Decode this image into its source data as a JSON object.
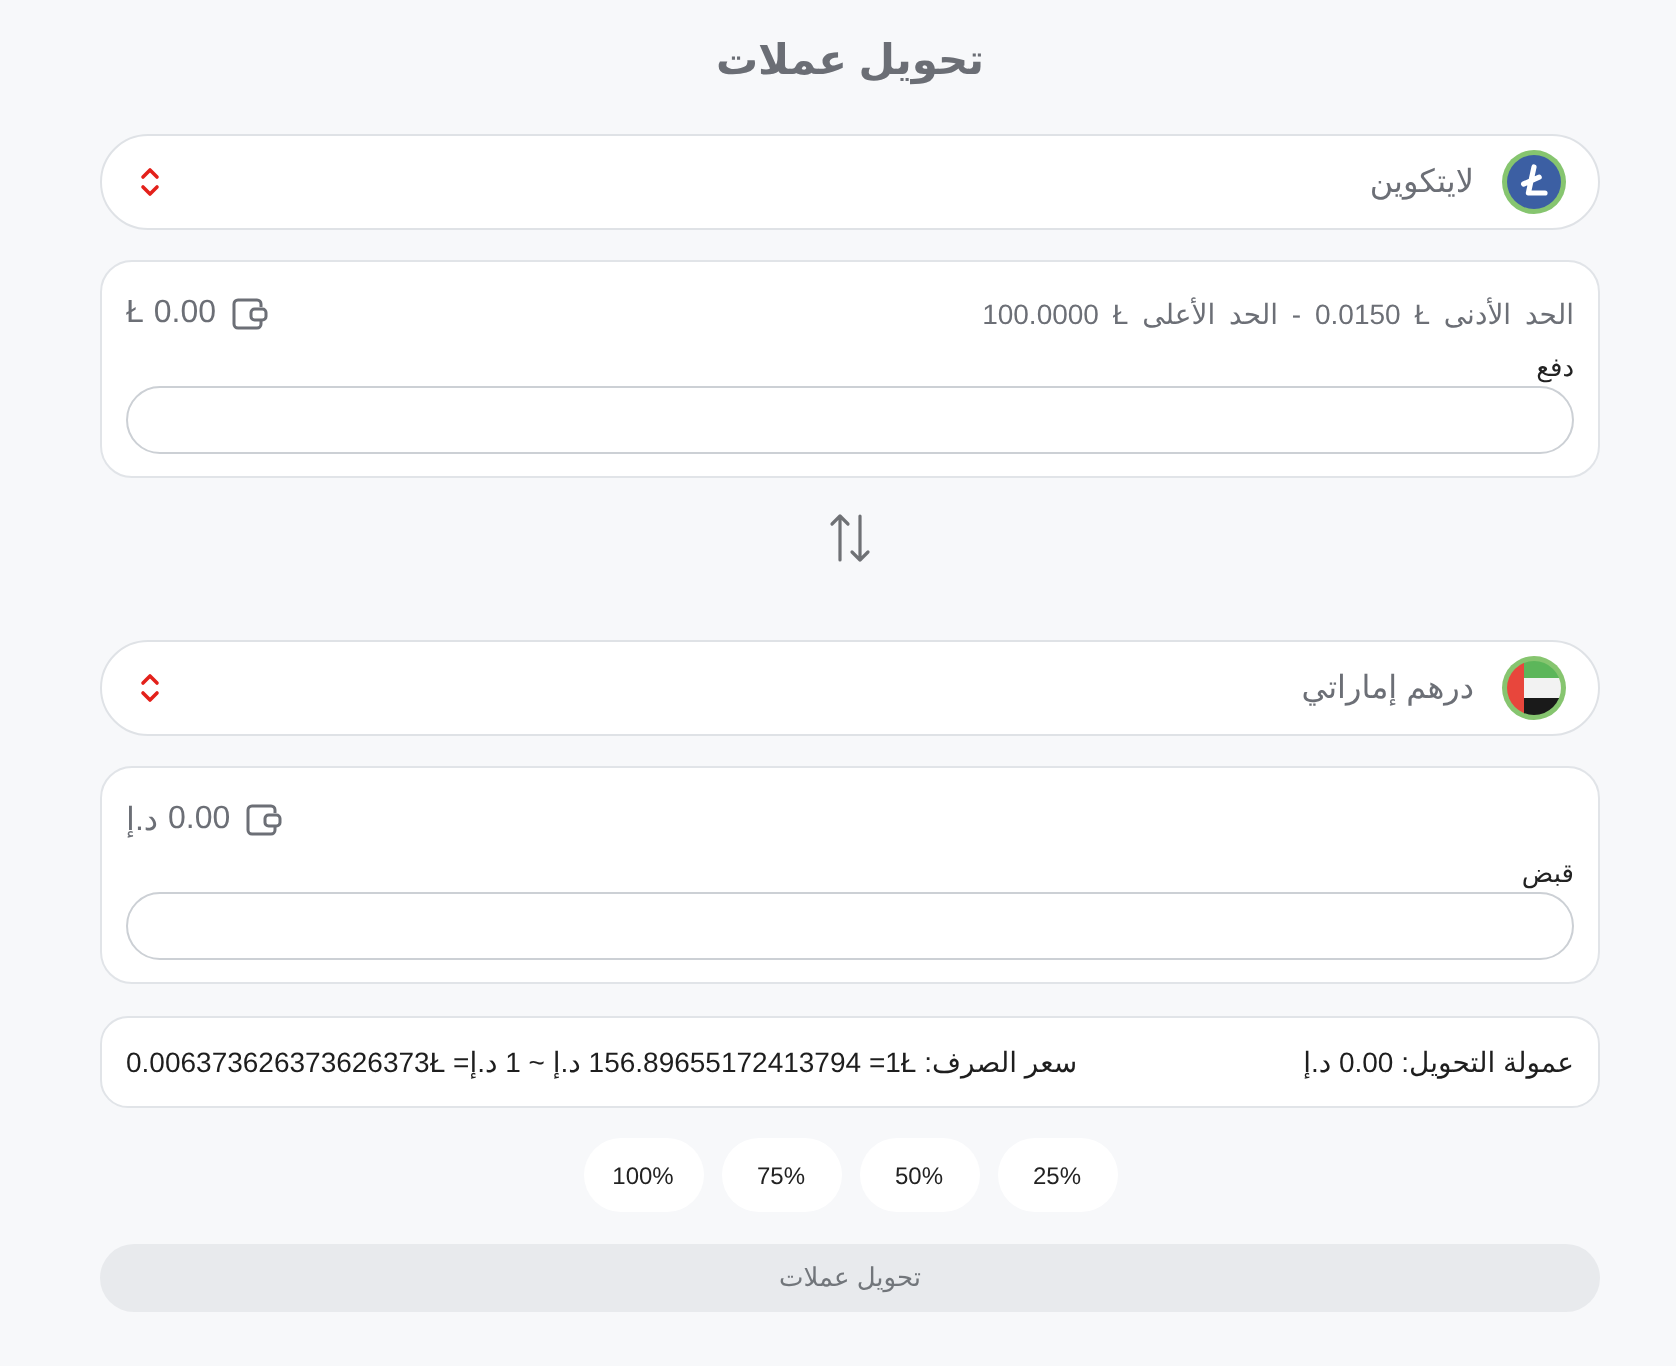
{
  "title": "تحويل عملات",
  "pay": {
    "currency": {
      "name": "لايتكوين"
    },
    "limits": {
      "min": {
        "label": "الحد الأدنى",
        "symbol": "Ł",
        "amount": "0.0150"
      },
      "separator": "-",
      "max": {
        "label": "الحد الأعلى",
        "symbol": "Ł",
        "amount": "100.0000"
      }
    },
    "balance": {
      "amount": "0.00",
      "symbol": "Ł"
    },
    "field_label": "دفع"
  },
  "receive": {
    "currency": {
      "name": "درهم إماراتي"
    },
    "balance": {
      "amount": "0.00",
      "symbol": "د.إ"
    },
    "field_label": "قبض"
  },
  "summary": {
    "fee": {
      "label": "عمولة التحويل:",
      "amount": "0.00",
      "symbol": "د.إ"
    },
    "exchange_rate": {
      "label": "سعر الصرف:",
      "parts": [
        [
          "Ł",
          "1="
        ],
        [
          "156.89655172413794 د.إ"
        ],
        [
          "~"
        ],
        [
          "1 د.إ="
        ],
        [
          "Ł",
          "0.006373626373626373"
        ]
      ]
    }
  },
  "percent_buttons": [
    "25%",
    "50%",
    "75%",
    "100%"
  ],
  "submit_button": {
    "label": "تحويل عملات",
    "disabled": true
  }
}
